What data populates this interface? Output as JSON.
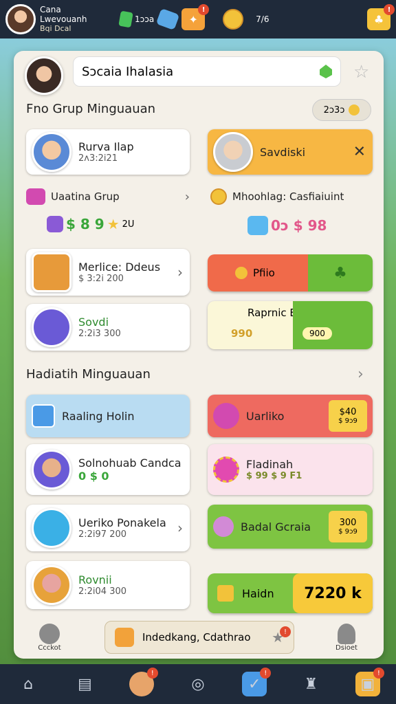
{
  "topbar": {
    "name": "Cana",
    "subtitle": "Lwevouanh",
    "sub2": "Bqi Dcal",
    "res1": "1ɔɔa",
    "res2": "7/6"
  },
  "search": {
    "value": "Sɔcaia Ihalasia"
  },
  "section1": {
    "title": "Fno Grup Minguauan",
    "pill_value": "2ɔ3ɔ"
  },
  "left_cards": [
    {
      "title": "Rurva Ilap",
      "sub": "2ʌ3:2i21"
    },
    {
      "title": "Merlice: Ddeus",
      "sub": "$ 3:2i 200"
    },
    {
      "title": "Sovdi",
      "sub": "2:2i3 300"
    }
  ],
  "left_row": {
    "label": "Uaatina Grup",
    "value": "2U",
    "tokens": "$ 8 9"
  },
  "right_cards": {
    "svdiski": "Savdiski",
    "mhoohlag": "Mhoohlag: Casfiaiuint",
    "mh_tokens": "0ɔ $ 98",
    "btn_left": "Pfiio",
    "rapnic": "Raprnic Borkuo",
    "rap_left": "990",
    "rap_right": "900"
  },
  "section2": {
    "title": "Hadiatih Minguauan"
  },
  "left_cards2": [
    {
      "title": "Raaling Holin"
    },
    {
      "title": "Solnohuab Candca",
      "sub": "0 $ 0"
    },
    {
      "title": "Ueriko Ponakela",
      "sub": "2:2i97 200"
    },
    {
      "title": "Rovnii",
      "sub": "2:2i04 300"
    }
  ],
  "right_cards2": {
    "uarliko": "Uarliko",
    "uarliko_v1": "$40",
    "uarliko_v2": "$ 9ɔ9",
    "fladinah": "Fladinah",
    "fladinah_sub": "$ 99 $ 9 F1",
    "badal": "Badal Gcraia",
    "badal_v1": "300",
    "badal_v2": "$ 9ɔ9",
    "haidn": "Haidn",
    "haidn_v": "7220 k"
  },
  "footer": {
    "left_label": "Ccckot",
    "center_label": "Indedkang, Cdathrao",
    "right_label": "Dsioet"
  }
}
